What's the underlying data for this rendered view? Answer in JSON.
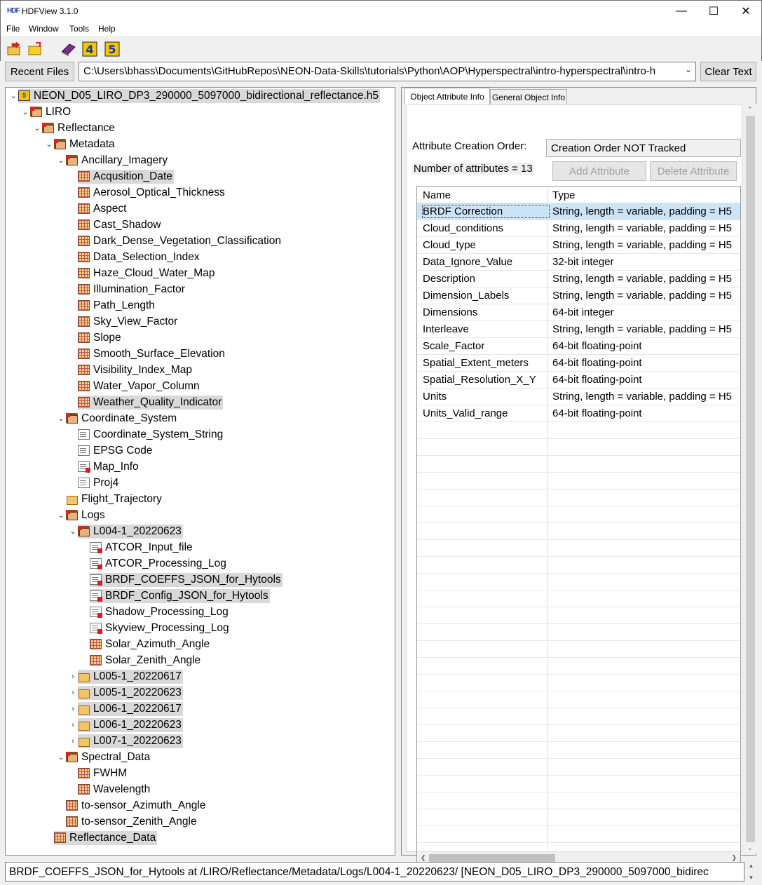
{
  "window": {
    "title": "HDFView 3.1.0",
    "logo_text": "HDF",
    "minimize": "—",
    "maximize": "☐",
    "close": "✕"
  },
  "menu": [
    "File",
    "Window",
    "Tools",
    "Help"
  ],
  "toolbar": {
    "icons": [
      "open-file-icon",
      "open-folder-icon",
      "user-guide-book-icon",
      "hdf4-library-icon",
      "hdf5-library-icon"
    ],
    "recent_files_label": "Recent Files",
    "path_value": "C:\\Users\\bhass\\Documents\\GitHubRepos\\NEON-Data-Skills\\tutorials\\Python\\AOP\\Hyperspectral\\intro-hyperspectral\\intro-h",
    "clear_text_label": "Clear Text"
  },
  "tree": [
    {
      "label": "NEON_D05_LIRO_DP3_290000_5097000_bidirectional_reflectance.h5",
      "level": 0,
      "icon": "h5",
      "chev": "open",
      "sel": true
    },
    {
      "label": "LIRO",
      "level": 1,
      "icon": "folder",
      "chev": "open"
    },
    {
      "label": "Reflectance",
      "level": 2,
      "icon": "folder",
      "chev": "open"
    },
    {
      "label": "Metadata",
      "level": 3,
      "icon": "folder",
      "chev": "open"
    },
    {
      "label": "Ancillary_Imagery",
      "level": 4,
      "icon": "folder",
      "chev": "open"
    },
    {
      "label": "Acqusition_Date",
      "level": 5,
      "icon": "dataset",
      "chev": "none",
      "sel": true
    },
    {
      "label": "Aerosol_Optical_Thickness",
      "level": 5,
      "icon": "dataset",
      "chev": "none"
    },
    {
      "label": "Aspect",
      "level": 5,
      "icon": "dataset",
      "chev": "none"
    },
    {
      "label": "Cast_Shadow",
      "level": 5,
      "icon": "dataset",
      "chev": "none"
    },
    {
      "label": "Dark_Dense_Vegetation_Classification",
      "level": 5,
      "icon": "dataset",
      "chev": "none"
    },
    {
      "label": "Data_Selection_Index",
      "level": 5,
      "icon": "dataset",
      "chev": "none"
    },
    {
      "label": "Haze_Cloud_Water_Map",
      "level": 5,
      "icon": "dataset",
      "chev": "none"
    },
    {
      "label": "Illumination_Factor",
      "level": 5,
      "icon": "dataset",
      "chev": "none"
    },
    {
      "label": "Path_Length",
      "level": 5,
      "icon": "dataset",
      "chev": "none"
    },
    {
      "label": "Sky_View_Factor",
      "level": 5,
      "icon": "dataset",
      "chev": "none"
    },
    {
      "label": "Slope",
      "level": 5,
      "icon": "dataset",
      "chev": "none"
    },
    {
      "label": "Smooth_Surface_Elevation",
      "level": 5,
      "icon": "dataset",
      "chev": "none"
    },
    {
      "label": "Visibility_Index_Map",
      "level": 5,
      "icon": "dataset",
      "chev": "none"
    },
    {
      "label": "Water_Vapor_Column",
      "level": 5,
      "icon": "dataset",
      "chev": "none"
    },
    {
      "label": "Weather_Quality_Indicator",
      "level": 5,
      "icon": "dataset",
      "chev": "none",
      "sel": true
    },
    {
      "label": "Coordinate_System",
      "level": 4,
      "icon": "folder",
      "chev": "open"
    },
    {
      "label": "Coordinate_System_String",
      "level": 5,
      "icon": "doc",
      "chev": "none"
    },
    {
      "label": "EPSG Code",
      "level": 5,
      "icon": "doc",
      "chev": "none"
    },
    {
      "label": "Map_Info",
      "level": 5,
      "icon": "doc-red",
      "chev": "none"
    },
    {
      "label": "Proj4",
      "level": 5,
      "icon": "doc",
      "chev": "none"
    },
    {
      "label": "Flight_Trajectory",
      "level": 4,
      "icon": "folder-c",
      "chev": "none"
    },
    {
      "label": "Logs",
      "level": 4,
      "icon": "folder",
      "chev": "open"
    },
    {
      "label": "L004-1_20220623",
      "level": 5,
      "icon": "folder",
      "chev": "open",
      "sel": true
    },
    {
      "label": "ATCOR_Input_file",
      "level": 6,
      "icon": "doc-red",
      "chev": "none"
    },
    {
      "label": "ATCOR_Processing_Log",
      "level": 6,
      "icon": "doc-red",
      "chev": "none"
    },
    {
      "label": "BRDF_COEFFS_JSON_for_Hytools",
      "level": 6,
      "icon": "doc-red",
      "chev": "none",
      "sel": true
    },
    {
      "label": "BRDF_Config_JSON_for_Hytools",
      "level": 6,
      "icon": "doc-red",
      "chev": "none",
      "sel": true
    },
    {
      "label": "Shadow_Processing_Log",
      "level": 6,
      "icon": "doc-red",
      "chev": "none"
    },
    {
      "label": "Skyview_Processing_Log",
      "level": 6,
      "icon": "doc-red",
      "chev": "none"
    },
    {
      "label": "Solar_Azimuth_Angle",
      "level": 6,
      "icon": "dataset",
      "chev": "none"
    },
    {
      "label": "Solar_Zenith_Angle",
      "level": 6,
      "icon": "dataset",
      "chev": "none"
    },
    {
      "label": "L005-1_20220617",
      "level": 5,
      "icon": "folder-c",
      "chev": "closed",
      "sel": true
    },
    {
      "label": "L005-1_20220623",
      "level": 5,
      "icon": "folder-c",
      "chev": "closed",
      "sel": true
    },
    {
      "label": "L006-1_20220617",
      "level": 5,
      "icon": "folder-c",
      "chev": "closed",
      "sel": true
    },
    {
      "label": "L006-1_20220623",
      "level": 5,
      "icon": "folder-c",
      "chev": "closed",
      "sel": true
    },
    {
      "label": "L007-1_20220623",
      "level": 5,
      "icon": "folder-c",
      "chev": "closed",
      "sel": true
    },
    {
      "label": "Spectral_Data",
      "level": 4,
      "icon": "folder",
      "chev": "open"
    },
    {
      "label": "FWHM",
      "level": 5,
      "icon": "dataset",
      "chev": "none"
    },
    {
      "label": "Wavelength",
      "level": 5,
      "icon": "dataset",
      "chev": "none"
    },
    {
      "label": "to-sensor_Azimuth_Angle",
      "level": 4,
      "icon": "dataset",
      "chev": "none"
    },
    {
      "label": "to-sensor_Zenith_Angle",
      "level": 4,
      "icon": "dataset",
      "chev": "none"
    },
    {
      "label": "Reflectance_Data",
      "level": 3,
      "icon": "dataset",
      "chev": "none",
      "sel": true
    }
  ],
  "panel": {
    "tabs": [
      "Object Attribute Info",
      "General Object Info"
    ],
    "creation_order_label": "Attribute Creation Order:",
    "creation_order_value": "Creation Order NOT Tracked",
    "num_attributes": "Number of attributes = 13",
    "add_attribute": "Add Attribute",
    "delete_attribute": "Delete Attribute",
    "columns": [
      "Name",
      "Type"
    ],
    "rows": [
      [
        "BRDF Correction",
        "String, length = variable, padding = H5"
      ],
      [
        "Cloud_conditions",
        "String, length = variable, padding = H5"
      ],
      [
        "Cloud_type",
        "String, length = variable, padding = H5"
      ],
      [
        "Data_Ignore_Value",
        "32-bit integer"
      ],
      [
        "Description",
        "String, length = variable, padding = H5"
      ],
      [
        "Dimension_Labels",
        "String, length = variable, padding = H5"
      ],
      [
        "Dimensions",
        "64-bit integer"
      ],
      [
        "Interleave",
        "String, length = variable, padding = H5"
      ],
      [
        "Scale_Factor",
        "64-bit floating-point"
      ],
      [
        "Spatial_Extent_meters",
        "64-bit floating-point"
      ],
      [
        "Spatial_Resolution_X_Y",
        "64-bit floating-point"
      ],
      [
        "Units",
        "String, length = variable, padding = H5"
      ],
      [
        "Units_Valid_range",
        "64-bit floating-point"
      ]
    ]
  },
  "status": "BRDF_COEFFS_JSON_for_Hytools  at  /LIRO/Reflectance/Metadata/Logs/L004-1_20220623/  [NEON_D05_LIRO_DP3_290000_5097000_bidirec"
}
